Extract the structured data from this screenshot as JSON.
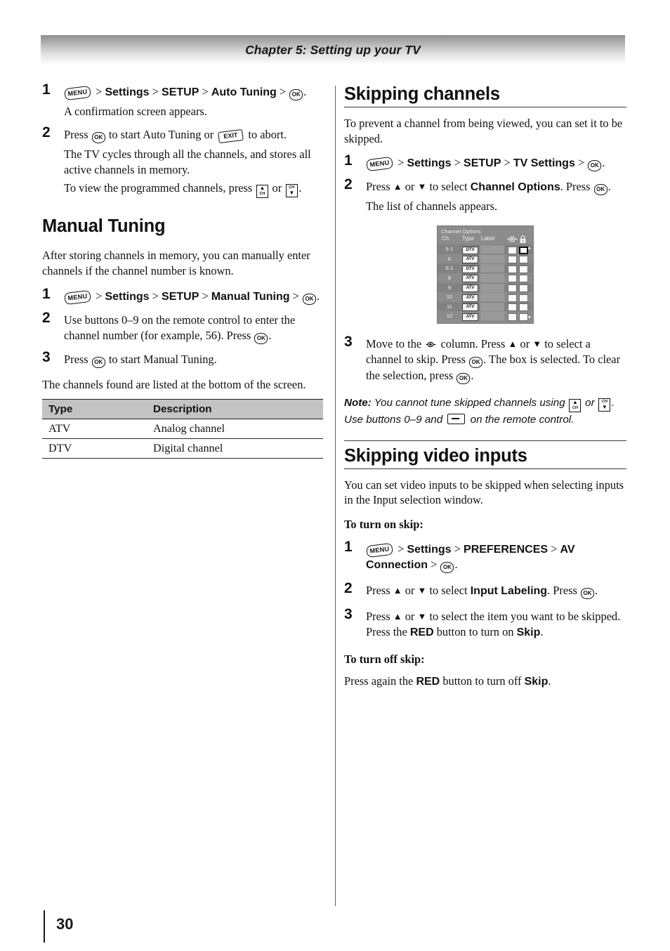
{
  "header": {
    "chapter_title": "Chapter 5: Setting up your TV"
  },
  "page": {
    "number": "30"
  },
  "icons": {
    "menu": "MENU",
    "ok": "OK",
    "exit": "EXIT",
    "ch_up": "CH",
    "ch_down": "CH",
    "dash": "–"
  },
  "left_column": {
    "auto_tuning_steps": [
      {
        "num": "1",
        "path_prefix": ">",
        "path": [
          "Settings",
          "SETUP",
          "Auto Tuning"
        ],
        "line1_tail": ".",
        "sub": "A confirmation screen appears."
      },
      {
        "num": "2",
        "text_a": "Press",
        "text_b": "to start Auto Tuning or",
        "text_c": "to abort.",
        "sub": "The TV cycles through all the channels, and stores all active channels in memory.",
        "sub2_a": "To view the programmed channels, press",
        "sub2_b": "or",
        "sub2_c": "."
      }
    ],
    "manual_tuning": {
      "heading": "Manual Tuning",
      "intro": "After storing channels in memory, you can manually enter channels if the channel number is known.",
      "steps": [
        {
          "num": "1",
          "path": [
            "Settings",
            "SETUP",
            "Manual Tuning"
          ],
          "tail": "."
        },
        {
          "num": "2",
          "text": "Use buttons 0–9 on the remote control to enter the channel number (for example, 56). Press",
          "tail": "."
        },
        {
          "num": "3",
          "text_a": "Press",
          "text_b": "to start Manual Tuning."
        }
      ],
      "after": "The channels found are listed at the bottom of the screen.",
      "table": {
        "headers": [
          "Type",
          "Description"
        ],
        "rows": [
          [
            "ATV",
            "Analog channel"
          ],
          [
            "DTV",
            "Digital channel"
          ]
        ]
      }
    }
  },
  "right_column": {
    "skipping_channels": {
      "heading": "Skipping channels",
      "intro": "To prevent a channel from being viewed, you can set it to be skipped.",
      "steps": [
        {
          "num": "1",
          "path": [
            "Settings",
            "SETUP",
            "TV Settings"
          ],
          "tail": "."
        },
        {
          "num": "2",
          "text_a": "Press",
          "arrow_up": "▲",
          "text_or": "or",
          "arrow_down": "▼",
          "text_b": "to select",
          "bold": "Channel Options",
          "text_c": ". Press",
          "tail": ".",
          "sub": "The list of channels appears."
        },
        {
          "num": "3",
          "text_a": "Move to the",
          "text_b": "column. Press",
          "arrow_up": "▲",
          "text_or": "or",
          "arrow_down": "▼",
          "text_c": "to select a channel to skip. Press",
          "text_d": ". The box is selected. To clear the selection, press",
          "tail": "."
        }
      ],
      "note": {
        "label": "Note:",
        "text_a": "You cannot tune skipped channels using",
        "text_or": "or",
        "text_b": ". Use buttons 0–9 and",
        "text_c": "on the remote control."
      },
      "tv_screenshot": {
        "title": "Channel Options",
        "columns": [
          "Ch.",
          "Type",
          "Label",
          "skip-icon",
          "lock-icon"
        ],
        "rows": [
          {
            "ch": "5-1",
            "type": "DTV",
            "label": "",
            "skip": false,
            "lock": false,
            "lock_selected": true
          },
          {
            "ch": "6",
            "type": "ATV",
            "label": "",
            "skip": false,
            "lock": false,
            "lock_selected": false
          },
          {
            "ch": "6-1",
            "type": "DTV",
            "label": "",
            "skip": false,
            "lock": false,
            "lock_selected": false
          },
          {
            "ch": "8",
            "type": "ATV",
            "label": "",
            "skip": false,
            "lock": false,
            "lock_selected": false
          },
          {
            "ch": "9",
            "type": "ATV",
            "label": "",
            "skip": false,
            "lock": false,
            "lock_selected": false
          },
          {
            "ch": "10",
            "type": "ATV",
            "label": "",
            "skip": false,
            "lock": false,
            "lock_selected": false
          },
          {
            "ch": "11",
            "type": "ATV",
            "label": "",
            "skip": false,
            "lock": false,
            "lock_selected": false
          },
          {
            "ch": "12",
            "type": "ATV",
            "label": "",
            "skip": false,
            "lock": false,
            "lock_selected": false
          }
        ],
        "scroll_up": "▲",
        "scroll_down": "▼"
      }
    },
    "skipping_video_inputs": {
      "heading": "Skipping video inputs",
      "intro": "You can set video inputs to be skipped when selecting inputs in the Input selection window.",
      "turn_on_heading": "To turn on skip:",
      "steps": [
        {
          "num": "1",
          "path": [
            "Settings",
            "PREFERENCES",
            "AV Connection"
          ],
          "tail": "."
        },
        {
          "num": "2",
          "text_a": "Press",
          "arrow_up": "▲",
          "text_or": "or",
          "arrow_down": "▼",
          "text_b": "to select",
          "bold": "Input Labeling",
          "text_c": ". Press",
          "tail": "."
        },
        {
          "num": "3",
          "text_a": "Press",
          "arrow_up": "▲",
          "text_or": "or",
          "arrow_down": "▼",
          "text_b": "to select the item you want to be skipped. Press the",
          "bold_red": "RED",
          "text_c": "button to turn on",
          "bold_skip": "Skip",
          "tail": "."
        }
      ],
      "turn_off_heading": "To turn off skip:",
      "turn_off_text_a": "Press again the",
      "turn_off_bold_red": "RED",
      "turn_off_text_b": "button to turn off",
      "turn_off_bold_skip": "Skip",
      "turn_off_tail": "."
    }
  },
  "colors": {
    "header_gradient_top": "#8f8f8f",
    "rule": "#3a3a3a",
    "table_header_bg": "#c3c3c3",
    "tv_bg": "#8c8c8c"
  }
}
